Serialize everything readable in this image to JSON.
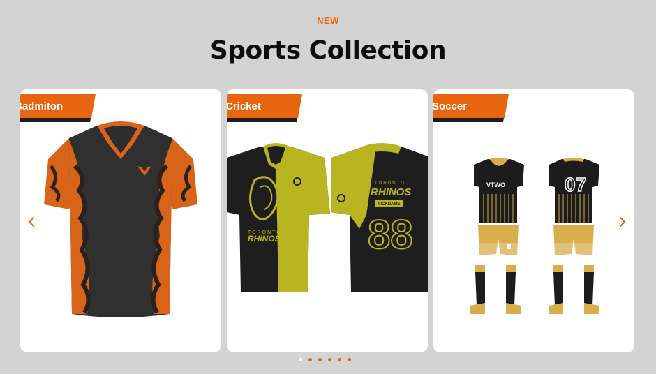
{
  "section": {
    "eyebrow": "NEW",
    "title": "Sports Collection"
  },
  "cards": [
    {
      "label": "Badmiton",
      "image": "orange-black-badminton-jersey"
    },
    {
      "label": "Cricket",
      "image": "yellow-black-cricket-polo-front-back"
    },
    {
      "label": "Soccer",
      "image": "black-gold-soccer-kit-front-back"
    }
  ],
  "jersey_text": {
    "cricket_team_line1": "TORONTO",
    "cricket_team_line2": "RHINOS",
    "cricket_nickname": "NICKNAME",
    "cricket_number": "88",
    "soccer_brand": "VTWO",
    "soccer_number": "07"
  },
  "nav": {
    "prev_icon": "chevron-left-icon",
    "next_icon": "chevron-right-icon"
  },
  "pagination": {
    "count": 6,
    "active_index": 0
  },
  "colors": {
    "accent": "#e8650f",
    "background": "#d3d3d3",
    "title": "#0d0d0d",
    "card": "#ffffff",
    "cricket_yellow": "#b9b422",
    "soccer_gold": "#d9ad4a"
  }
}
